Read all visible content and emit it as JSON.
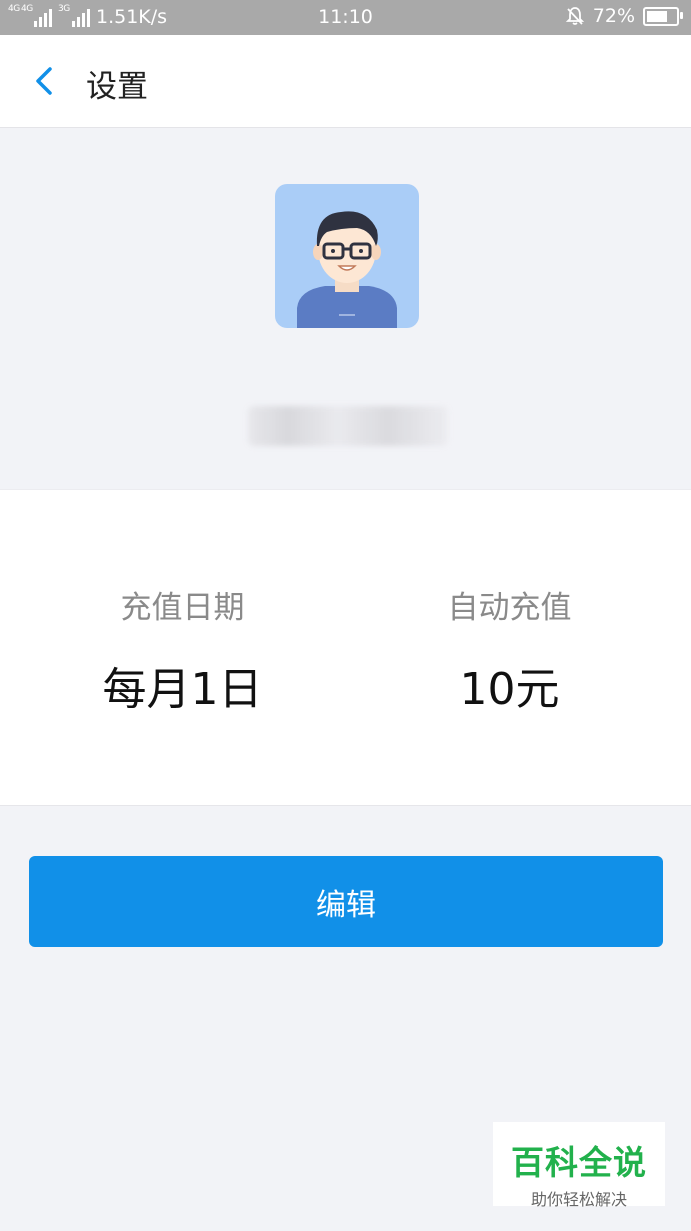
{
  "status_bar": {
    "network_label_1": "4G",
    "network_label_2": "4G",
    "network_label_3": "3G",
    "speed": "1.51K/s",
    "time": "11:10",
    "battery": "72%",
    "battery_level": 0.72
  },
  "navbar": {
    "title": "设置",
    "back_icon": "chevron-left-icon",
    "accent_color": "#1190e8"
  },
  "profile": {
    "avatar_icon": "user-avatar-icon",
    "name_redacted": ""
  },
  "recharge": {
    "date_label": "充值日期",
    "date_value": "每月1日",
    "amount_label": "自动充值",
    "amount_value": "10元"
  },
  "actions": {
    "edit_label": "编辑"
  },
  "watermark": {
    "title": "百科全说",
    "subtitle": "助你轻松解决"
  }
}
